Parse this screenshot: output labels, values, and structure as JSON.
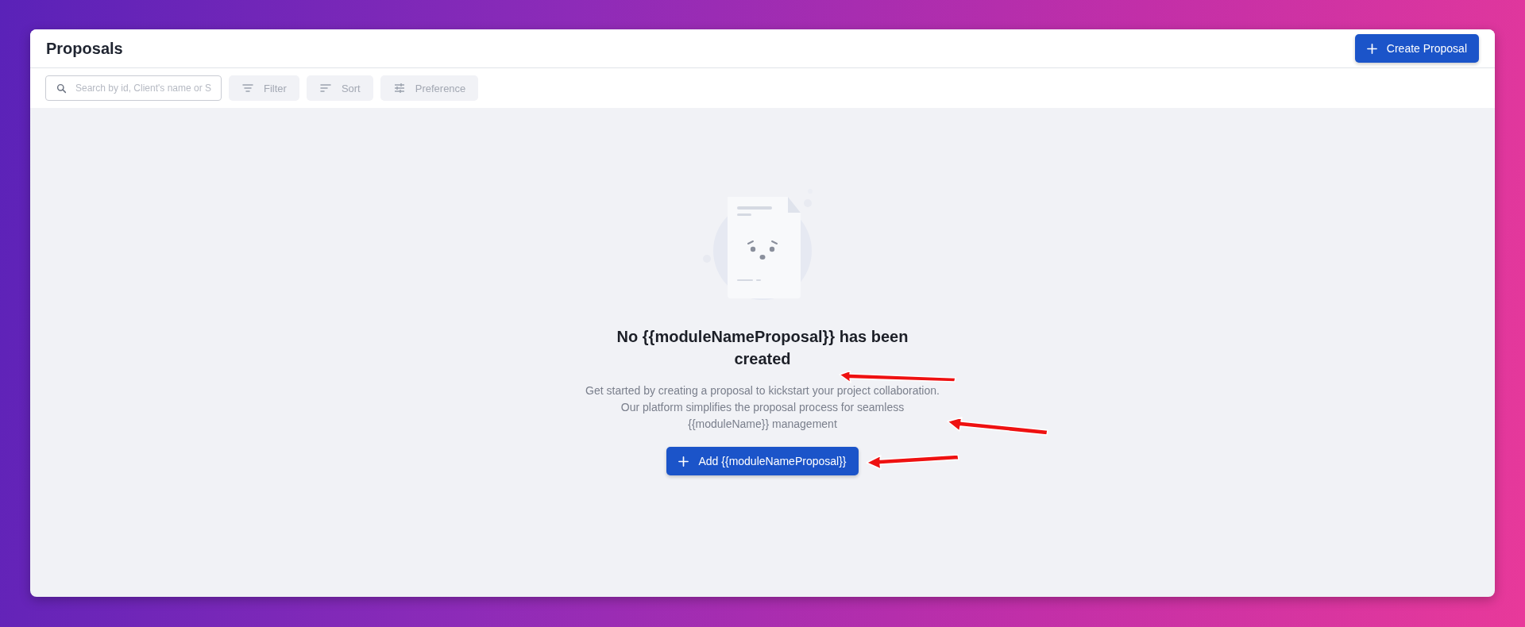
{
  "header": {
    "title": "Proposals",
    "create_button": "Create Proposal"
  },
  "toolbar": {
    "search": {
      "placeholder": "Search by id, Client's name or S"
    },
    "buttons": [
      {
        "label": "Filter",
        "kind": "filter"
      },
      {
        "label": "Sort",
        "kind": "sort"
      },
      {
        "label": "Preference",
        "kind": "preference"
      }
    ]
  },
  "empty_state": {
    "heading": "No {{moduleNameProposal}} has been created",
    "description": "Get started by creating a proposal to kickstart your project collaboration. Our platform simplifies the proposal process for seamless {{moduleName}} management",
    "button": "Add {{moduleNameProposal}}"
  }
}
